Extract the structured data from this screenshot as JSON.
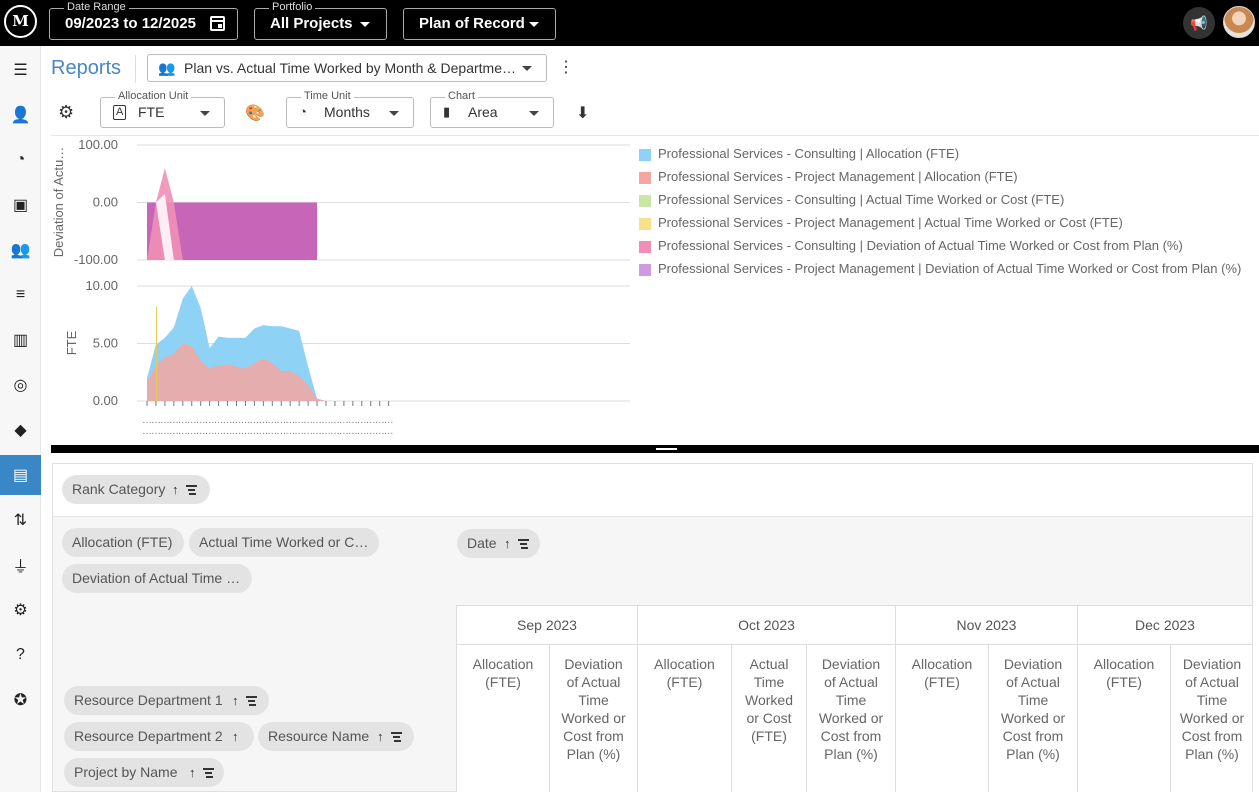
{
  "topbar": {
    "logo_text": "M",
    "date_range": {
      "label": "Date Range",
      "value": "09/2023 to 12/2025"
    },
    "portfolio": {
      "label": "Portfolio",
      "value": "All Projects"
    },
    "plan": {
      "value": "Plan of Record"
    }
  },
  "sidebar": {
    "items": [
      {
        "icon": "menu-icon",
        "glyph": "☰"
      },
      {
        "icon": "person-list-icon",
        "glyph": "👤"
      },
      {
        "icon": "donut-icon",
        "glyph": "◔"
      },
      {
        "icon": "assignment-icon",
        "glyph": "▣"
      },
      {
        "icon": "people-icon",
        "glyph": "👥"
      },
      {
        "icon": "list-icon",
        "glyph": "≡"
      },
      {
        "icon": "columns-icon",
        "glyph": "▥"
      },
      {
        "icon": "target-icon",
        "glyph": "◎"
      },
      {
        "icon": "direction-icon",
        "glyph": "◆"
      },
      {
        "icon": "reports-icon",
        "glyph": "▤",
        "active": true
      },
      {
        "icon": "swap-icon",
        "glyph": "⇅"
      },
      {
        "icon": "plug-icon",
        "glyph": "⏚"
      },
      {
        "icon": "settings-icon",
        "glyph": "⚙"
      },
      {
        "icon": "help-icon",
        "glyph": "?"
      },
      {
        "icon": "compass-icon",
        "glyph": "✪"
      }
    ]
  },
  "header": {
    "title": "Reports",
    "report_name": "Plan vs. Actual Time Worked by Month & Departme…"
  },
  "controls": {
    "allocation_unit": {
      "label": "Allocation Unit",
      "value": "FTE"
    },
    "time_unit": {
      "label": "Time Unit",
      "value": "Months"
    },
    "chart": {
      "label": "Chart",
      "value": "Area"
    }
  },
  "colors": {
    "consult_alloc": "#8ed3f5",
    "pm_alloc": "#f4a6a0",
    "consult_actual": "#c9e6a8",
    "pm_actual": "#f7e08a",
    "consult_dev": "#f08fb5",
    "pm_dev": "#cf9be0",
    "top_area": "#c765b8",
    "accent": "#3a87c8"
  },
  "chart_data": [
    {
      "type": "area",
      "ylabel": "Deviation of Actu…",
      "ylim": [
        -100,
        100
      ],
      "yticks": [
        "100.00",
        "0.00",
        "-100.00"
      ],
      "series": [
        {
          "name": "Professional Services - Consulting | Deviation of Actual Time Worked or Cost from Plan (%)",
          "values": [
            -100,
            0,
            60,
            0,
            -100,
            null,
            null,
            null,
            null,
            null,
            null,
            null,
            null,
            null,
            null,
            null,
            null,
            null,
            null,
            null,
            null,
            null,
            null,
            null,
            null,
            null,
            null,
            null
          ]
        },
        {
          "name": "Professional Services - Project Management | Deviation of Actual Time Worked or Cost from Plan (%)",
          "values": [
            -100,
            0,
            0,
            0,
            0,
            0,
            0,
            0,
            0,
            0,
            0,
            0,
            0,
            0,
            0,
            0,
            0,
            0,
            0,
            0,
            null,
            null,
            null,
            null,
            null,
            null,
            null,
            null
          ]
        }
      ]
    },
    {
      "type": "area",
      "ylabel": "FTE",
      "ylim": [
        0,
        10
      ],
      "yticks": [
        "10.00",
        "5.00",
        "0.00"
      ],
      "x_tick_label": "…",
      "series": [
        {
          "name": "Professional Services - Consulting | Allocation (FTE)",
          "values": [
            2.0,
            4.9,
            5.5,
            6.4,
            8.9,
            10.0,
            8.1,
            4.6,
            5.6,
            5.5,
            5.5,
            5.5,
            6.3,
            6.6,
            6.5,
            6.5,
            6.3,
            6.1,
            3.0,
            0.2,
            0,
            0,
            0,
            0,
            0,
            0,
            0,
            0
          ]
        },
        {
          "name": "Professional Services - Project Management | Allocation (FTE)",
          "values": [
            1.7,
            3.1,
            3.8,
            4.1,
            5.0,
            4.8,
            3.5,
            2.8,
            3.1,
            3.2,
            3.0,
            2.8,
            3.3,
            3.7,
            3.3,
            2.6,
            2.6,
            2.2,
            1.4,
            0.2,
            0,
            0,
            0,
            0,
            0,
            0,
            0,
            0
          ]
        },
        {
          "name": "Professional Services - Consulting | Actual Time Worked or Cost (FTE)",
          "values": []
        },
        {
          "name": "Professional Services - Project Management | Actual Time Worked or Cost (FTE)",
          "values": [
            0,
            8.2,
            0
          ]
        }
      ]
    }
  ],
  "legend": [
    {
      "text": "Professional Services - Consulting | Allocation (FTE)",
      "color": "#8ed3f5"
    },
    {
      "text": "Professional Services - Project Management | Allocation (FTE)",
      "color": "#f4a6a0"
    },
    {
      "text": "Professional Services - Consulting | Actual Time Worked or Cost (FTE)",
      "color": "#c9e6a8"
    },
    {
      "text": "Professional Services - Project Management | Actual Time Worked or Cost (FTE)",
      "color": "#f7e08a"
    },
    {
      "text": "Professional Services - Consulting | Deviation of Actual Time Worked or Cost from Plan (%)",
      "color": "#f08fb5"
    },
    {
      "text": "Professional Services - Project Management | Deviation of Actual Time Worked or Cost from Plan (%)",
      "color": "#cf9be0"
    }
  ],
  "pivot": {
    "rank_category": "Rank Category",
    "values_chips": [
      "Allocation (FTE)",
      "Actual Time Worked or C…",
      "Deviation of Actual Time …"
    ],
    "date_chip": "Date",
    "row_chips": [
      "Resource Department 1",
      "Resource Department 2",
      "Resource Name",
      "Project by Name"
    ],
    "months": [
      "Sep 2023",
      "Oct 2023",
      "Nov 2023",
      "Dec 2023"
    ],
    "columns": [
      "Allocation (FTE)",
      "Deviation of Actual Time Worked or Cost from Plan (%)",
      "Allocation (FTE)",
      "Actual Time Worked or Cost (FTE)",
      "Deviation of Actual Time Worked or Cost from Plan (%)",
      "Allocation (FTE)",
      "Deviation of Actual Time Worked or Cost from Plan (%)",
      "Allocation (FTE)",
      "Deviation of Actual Time Worked or Cost from Plan (%)"
    ]
  }
}
